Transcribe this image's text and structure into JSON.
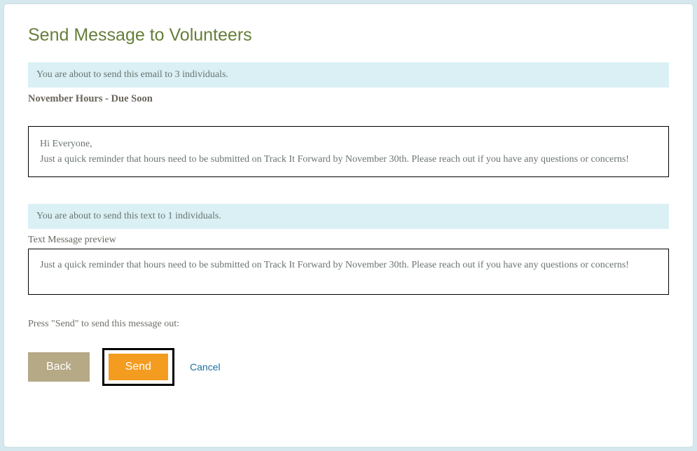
{
  "page_title": "Send Message to Volunteers",
  "email_section": {
    "banner_text": "You are about to send this email to 3 individuals.",
    "subject": "November Hours - Due Soon",
    "body_line1": "Hi Everyone,",
    "body_line2": "Just a quick reminder that hours need to be submitted on Track It Forward by November 30th. Please reach out if you have any questions or concerns!"
  },
  "text_section": {
    "banner_text": "You are about to send this text to 1 individuals.",
    "preview_label": "Text Message preview",
    "body": "Just a quick reminder that hours need to be submitted on Track It Forward by November 30th. Please reach out if you have any questions or concerns!"
  },
  "footer": {
    "press_send_label": "Press \"Send\" to send this message out:",
    "back_label": "Back",
    "send_label": "Send",
    "cancel_label": "Cancel"
  }
}
